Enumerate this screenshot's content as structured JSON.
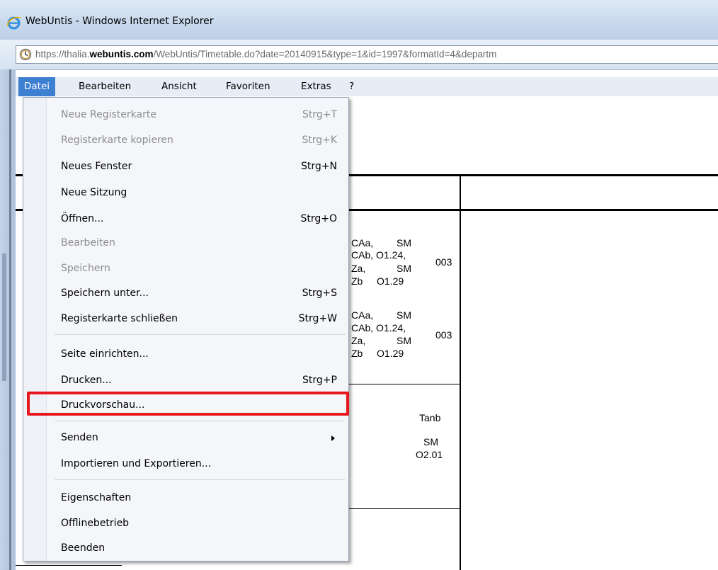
{
  "window": {
    "title": "WebUntis - Windows Internet Explorer",
    "url_prefix": "https://thalia.",
    "url_domain": "webuntis.com",
    "url_rest": "/WebUntis/Timetable.do?date=20140915&type=1&id=1997&formatId=4&departm",
    "colors": {
      "accent": "#3d7fd0",
      "highlight": "#e8161d"
    }
  },
  "menubar": {
    "items": [
      {
        "label": "Datei"
      },
      {
        "label": "Bearbeiten"
      },
      {
        "label": "Ansicht"
      },
      {
        "label": "Favoriten"
      },
      {
        "label": "Extras"
      },
      {
        "label": "?"
      }
    ]
  },
  "dropdown": {
    "items": [
      {
        "label": "Neue Registerkarte",
        "shortcut": "Strg+T"
      },
      {
        "label": "Registerkarte kopieren",
        "shortcut": "Strg+K"
      },
      {
        "label": "Neues Fenster",
        "shortcut": "Strg+N"
      },
      {
        "label": "Neue Sitzung",
        "shortcut": ""
      },
      {
        "label": "Öffnen...",
        "shortcut": "Strg+O"
      },
      {
        "label": "Bearbeiten",
        "shortcut": ""
      },
      {
        "label": "Speichern",
        "shortcut": ""
      },
      {
        "label": "Speichern unter...",
        "shortcut": "Strg+S"
      },
      {
        "label": "Registerkarte schließen",
        "shortcut": "Strg+W"
      },
      {
        "label": "Seite einrichten...",
        "shortcut": ""
      },
      {
        "label": "Drucken...",
        "shortcut": "Strg+P"
      },
      {
        "label": "Druckvorschau...",
        "shortcut": ""
      },
      {
        "label": "Senden",
        "shortcut": ""
      },
      {
        "label": "Importieren und Exportieren...",
        "shortcut": ""
      },
      {
        "label": "Eigenschaften",
        "shortcut": ""
      },
      {
        "label": "Offlinebetrieb",
        "shortcut": ""
      },
      {
        "label": "Beenden",
        "shortcut": ""
      }
    ]
  },
  "timetable": {
    "block1": {
      "l1": "CAa,",
      "l1b": "SM",
      "l2": "CAb, O1.24,",
      "l2b": "003",
      "l3": "Za,",
      "l3b": "SM",
      "l4": "Zb",
      "l4b": "O1.29"
    },
    "block2": {
      "l1": "CAa,",
      "l1b": "SM",
      "l2": "CAb, O1.24,",
      "l2b": "003",
      "l3": "Za,",
      "l3b": "SM",
      "l4": "Zb",
      "l4b": "O1.29"
    },
    "block3": {
      "l1": "Tanb",
      "l2": "SM",
      "l3": "O2.01"
    }
  }
}
